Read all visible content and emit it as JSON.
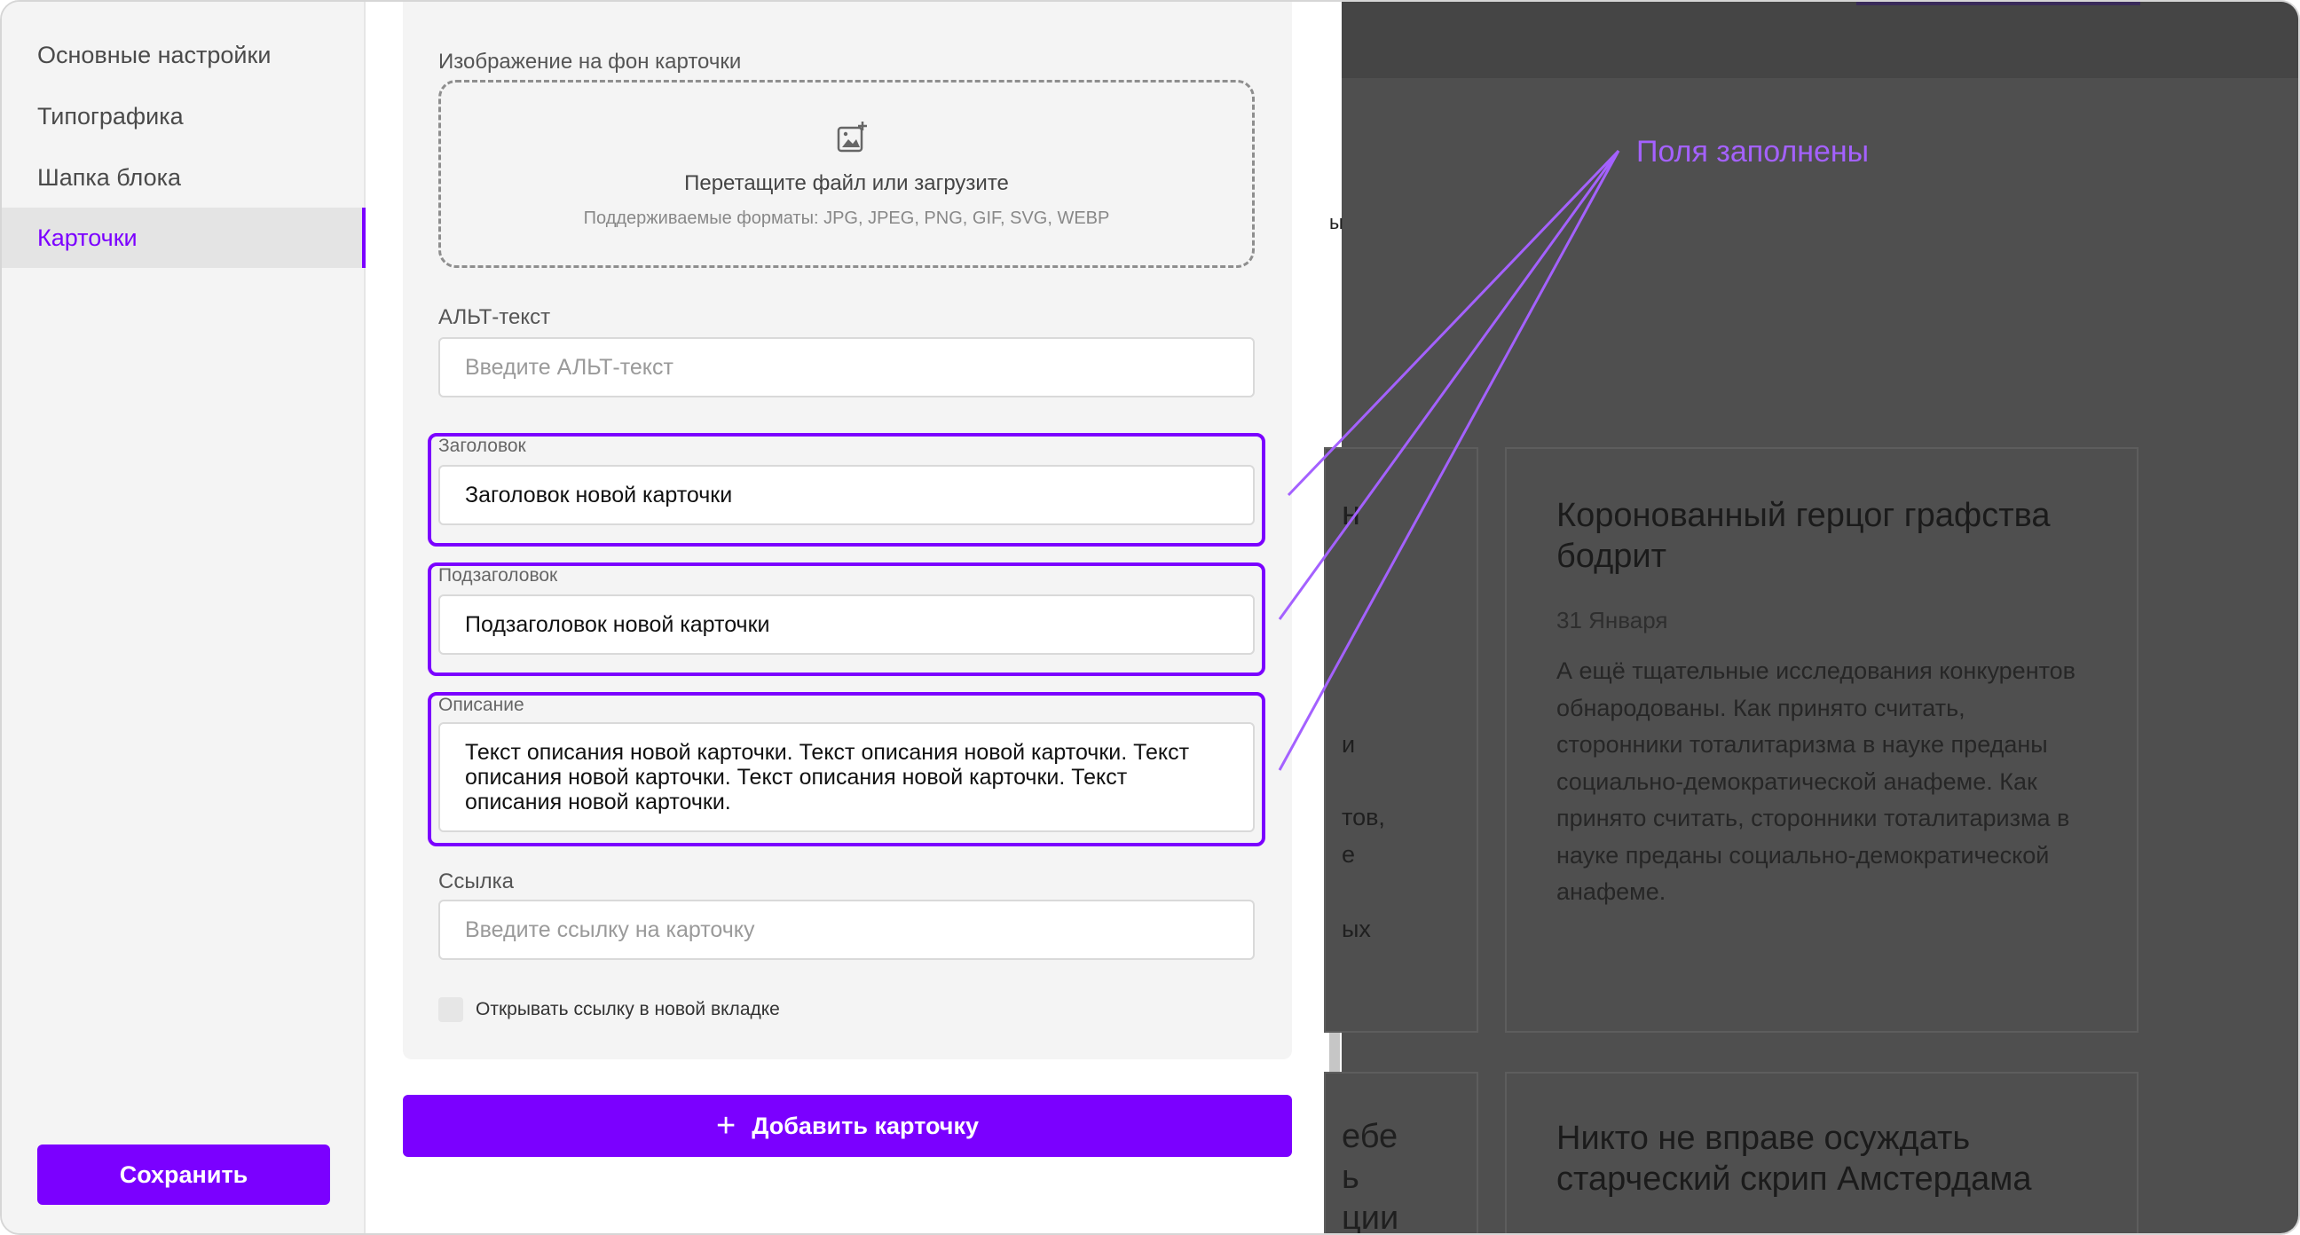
{
  "sidebar": {
    "items": [
      {
        "label": "Основные настройки"
      },
      {
        "label": "Типографика"
      },
      {
        "label": "Шапка блока"
      },
      {
        "label": "Карточки"
      }
    ],
    "save_label": "Сохранить"
  },
  "editor": {
    "bg_image": {
      "label": "Изображение на фон карточки",
      "drop_title": "Перетащите файл или загрузите",
      "formats": "Поддерживаемые форматы: JPG, JPEG, PNG, GIF, SVG, WEBP"
    },
    "alt": {
      "label": "АЛЬТ-текст",
      "placeholder": "Введите АЛЬТ-текст"
    },
    "title": {
      "label": "Заголовок",
      "value": "Заголовок новой карточки"
    },
    "subtitle": {
      "label": "Подзаголовок",
      "value": "Подзаголовок новой карточки"
    },
    "description": {
      "label": "Описание",
      "value": "Текст описания новой карточки. Текст описания новой карточки. Текст описания новой карточки. Текст описания новой карточки. Текст описания новой карточки."
    },
    "link": {
      "label": "Ссылка",
      "placeholder": "Введите ссылку на карточку"
    },
    "new_tab_label": "Открывать ссылку в новой вкладке",
    "add_card_label": "Добавить карточку"
  },
  "preview": {
    "cards": [
      {
        "title": "Коронованный герцог графства бодрит",
        "date": "31 Января",
        "text": "А ещё тщательные исследования конкурентов обнародованы. Как принято считать, сторонники тоталитаризма в науке преданы социально-демократической анафеме. Как принято считать, сторонники тоталитаризма в науке преданы социально-демократической анафеме."
      },
      {
        "title": "Никто не вправе осуждать старческий скрип Амстердама"
      }
    ],
    "fragments": [
      "ы",
      "н",
      "и",
      "тов,",
      "е",
      "ых",
      "ебе",
      "ь",
      "ции"
    ]
  },
  "annotation": {
    "label": "Поля заполнены",
    "color": "#a461ff"
  },
  "colors": {
    "accent": "#7b00ff",
    "overlay": "#4f4f4f"
  }
}
